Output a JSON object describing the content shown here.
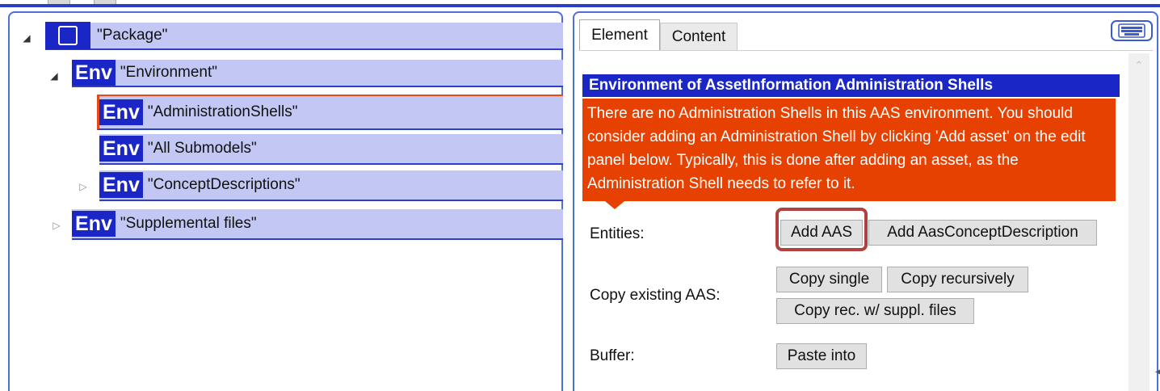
{
  "tree": {
    "package": {
      "label": "\"Package\""
    },
    "environment": {
      "badge": "Env",
      "label": "\"Environment\""
    },
    "children": [
      {
        "badge": "Env",
        "label": "\"AdministrationShells\""
      },
      {
        "badge": "Env",
        "label": "\"All Submodels\""
      },
      {
        "badge": "Env",
        "label": "\"ConceptDescriptions\""
      }
    ],
    "supplemental": {
      "badge": "Env",
      "label": "\"Supplemental files\""
    }
  },
  "tabs": [
    {
      "label": "Element",
      "active": true
    },
    {
      "label": "Content",
      "active": false
    }
  ],
  "panel": {
    "header": "Environment of AssetInformation Administration Shells",
    "warning": "There are no Administration Shells in this AAS environment. You should consider adding an Administration Shell by clicking 'Add asset' on the edit panel below. Typically, this is done after adding an asset, as the Administration Shell needs to refer to it.",
    "entities_label": "Entities:",
    "add_aas": "Add AAS",
    "add_concept": "Add AasConceptDescription",
    "copy_label": "Copy existing AAS:",
    "copy_single": "Copy single",
    "copy_recursively": "Copy recursively",
    "copy_rec_suppl": "Copy rec. w/ suppl. files",
    "buffer_label": "Buffer:",
    "paste_into": "Paste into"
  },
  "colors": {
    "accent_blue": "#1a27c6",
    "node_fill": "#c2c8f3",
    "warning_orange": "#e64100",
    "highlight_ring": "#b0413e"
  },
  "icons": [
    "expand-open-icon",
    "expand-closed-icon",
    "package-icon",
    "keyboard-icon",
    "scroll-up-icon"
  ]
}
